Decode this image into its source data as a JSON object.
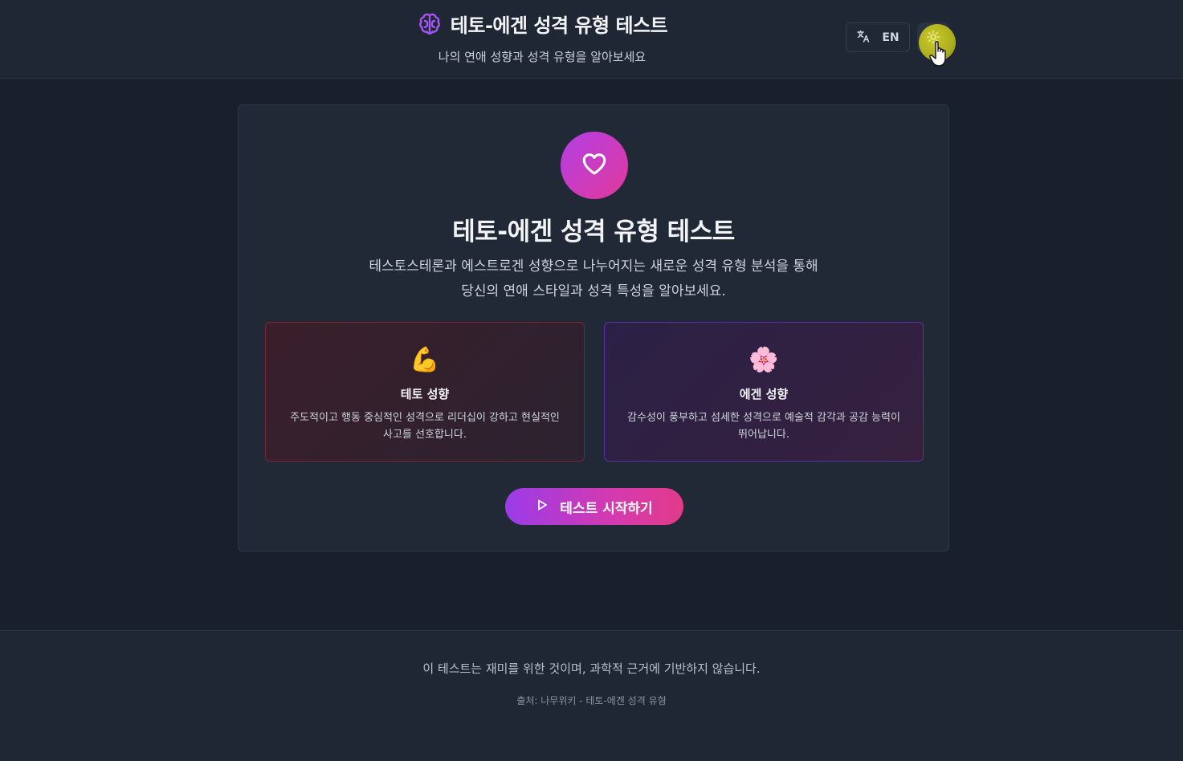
{
  "header": {
    "title": "테토-에겐 성격 유형 테스트",
    "subtitle": "나의 연애 성향과 성격 유형을 알아보세요",
    "brand_icon": "brain-icon",
    "language": {
      "icon": "translate-icon",
      "label": "EN"
    },
    "theme_toggle": {
      "icon": "sun-icon"
    }
  },
  "main": {
    "hero_icon": "heart-icon",
    "title": "테토-에겐 성격 유형 테스트",
    "description_line1": "테스토스테론과 에스트로겐 성향으로 나누어지는 새로운 성격 유형 분석을 통해",
    "description_line2": "당신의 연애 스타일과 성격 특성을 알아보세요.",
    "types": [
      {
        "emoji": "💪",
        "name": "테토 성향",
        "description": "주도적이고 행동 중심적인 성격으로 리더십이 강하고 현실적인 사고를 선호합니다."
      },
      {
        "emoji": "🌸",
        "name": "에겐 성향",
        "description": "감수성이 풍부하고 섬세한 성격으로 예술적 감각과 공감 능력이 뛰어납니다."
      }
    ],
    "start_button": {
      "icon": "play-icon",
      "label": "테스트 시작하기"
    }
  },
  "footer": {
    "disclaimer": "이 테스트는 재미를 위한 것이며, 과학적 근거에 기반하지 않습니다.",
    "source": "출처: 나무위키 - 테토-에겐 성격 유형"
  },
  "colors": {
    "accent_purple": "#a13ee6",
    "accent_pink": "#e0399a",
    "teto_border": "#7a2533",
    "egen_border": "#5b2ea2",
    "background": "#1b2230"
  }
}
